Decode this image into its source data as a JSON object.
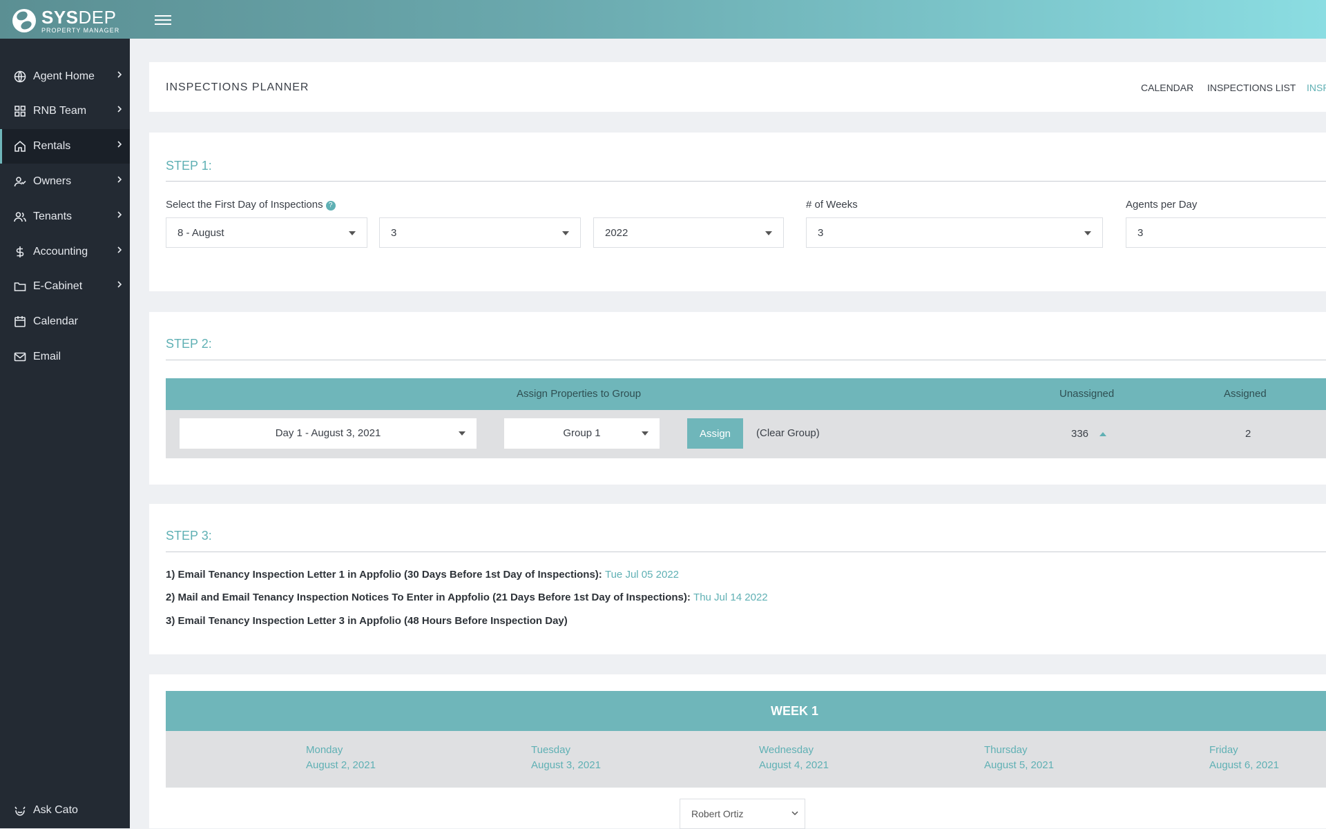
{
  "brand": {
    "name_bold": "SYS",
    "name_light": "DEP",
    "subtitle": "PROPERTY MANAGER"
  },
  "sidebar": {
    "items": [
      {
        "label": "Agent Home",
        "icon": "globe-icon"
      },
      {
        "label": "RNB Team",
        "icon": "grid-icon"
      },
      {
        "label": "Rentals",
        "icon": "home-icon",
        "active": true
      },
      {
        "label": "Owners",
        "icon": "user-check-icon"
      },
      {
        "label": "Tenants",
        "icon": "users-icon"
      },
      {
        "label": "Accounting",
        "icon": "dollar-icon"
      },
      {
        "label": "E-Cabinet",
        "icon": "folder-icon"
      },
      {
        "label": "Calendar",
        "icon": "calendar-icon"
      },
      {
        "label": "Email",
        "icon": "mail-icon"
      }
    ],
    "ask_cato": "Ask Cato"
  },
  "header": {
    "title": "INSPECTIONS PLANNER",
    "tabs": [
      "CALENDAR",
      "INSPECTIONS LIST",
      "INSP"
    ]
  },
  "step1": {
    "title": "STEP 1:",
    "first_day_label": "Select the First Day of Inspections",
    "help_icon": "?",
    "month": "8 - August",
    "day": "3",
    "year": "2022",
    "weeks_label": "# of Weeks",
    "weeks": "3",
    "agents_label": "Agents per Day",
    "agents": "3"
  },
  "step2": {
    "title": "STEP 2:",
    "col_assign": "Assign Properties to Group",
    "col_unassigned": "Unassigned",
    "col_assigned": "Assigned",
    "day_select": "Day 1 - August 3, 2021",
    "group_select": "Group 1",
    "assign_button": "Assign",
    "clear_group": "(Clear Group)",
    "unassigned_count": "336",
    "assigned_count": "2"
  },
  "step3": {
    "title": "STEP 3:",
    "lines": [
      {
        "text": "1) Email Tenancy Inspection Letter 1 in Appfolio (30 Days Before 1st Day of Inspections): ",
        "date": "Tue Jul 05 2022"
      },
      {
        "text": "2) Mail and Email Tenancy Inspection Notices To Enter in Appfolio (21 Days Before 1st Day of Inspections): ",
        "date": "Thu Jul 14 2022"
      },
      {
        "text": "3) Email Tenancy Inspection Letter 3 in Appfolio (48 Hours Before Inspection Day)",
        "date": ""
      }
    ]
  },
  "week": {
    "title": "WEEK 1",
    "days": [
      {
        "name": "Monday",
        "date": "August 2, 2021"
      },
      {
        "name": "Tuesday",
        "date": "August 3, 2021"
      },
      {
        "name": "Wednesday",
        "date": "August 4, 2021"
      },
      {
        "name": "Thursday",
        "date": "August 5, 2021"
      },
      {
        "name": "Friday",
        "date": "August 6, 2021"
      }
    ],
    "agent_select": "Robert Ortiz"
  },
  "colors": {
    "accent": "#5fb0b4",
    "sidebar": "#232a33",
    "table_head": "#6fb6ba"
  }
}
